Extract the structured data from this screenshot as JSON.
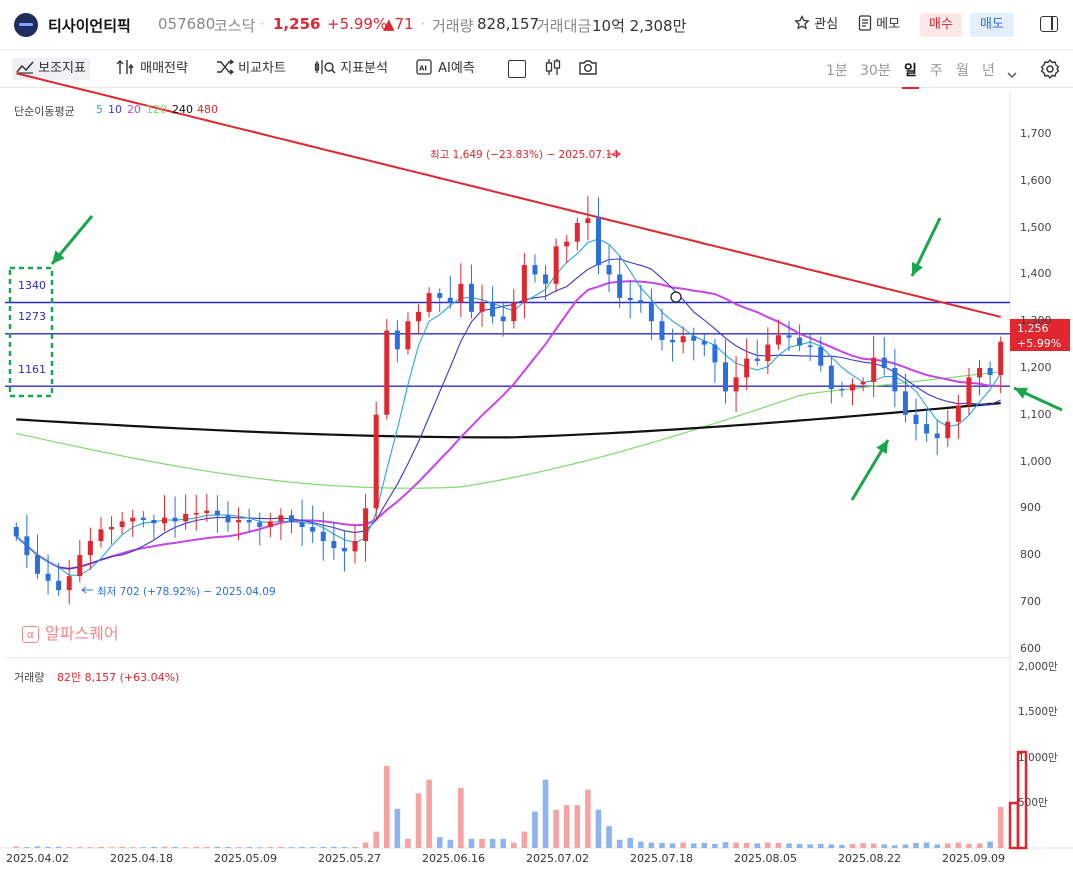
{
  "header": {
    "stock_name": "티사이언티픽",
    "stock_code": "057680",
    "market": "코스닥",
    "sep": "·",
    "price": "1,256",
    "change_pct": "+5.99%",
    "change_abs": "▲71",
    "volume_label": "거래량",
    "volume_value": "828,157",
    "amount_label": "거래대금",
    "amount_value": "10억 2,308만",
    "watch_label": "관심",
    "memo_label": "메모",
    "buy_label": "매수",
    "sell_label": "매도"
  },
  "toolbar": {
    "items": [
      "보조지표",
      "매매전략",
      "비교차트",
      "지표분석",
      "AI예측"
    ],
    "timeframes": [
      "1분",
      "30분",
      "일",
      "주",
      "월",
      "년"
    ],
    "selected_timeframe": "일"
  },
  "overlays": {
    "ma_title": "단순이동평균",
    "ma_periods": [
      "5",
      "10",
      "20",
      "120",
      "240",
      "480"
    ],
    "ma_colors": [
      "#2aa7d8",
      "#3b39c9",
      "#c944e6",
      "#7ddc6b",
      "#111111",
      "#e0262e"
    ],
    "high_note": "최고 1,649 (−23.83%) − 2025.07.14",
    "low_note": "최저 702 (+78.92%) − 2025.04.09",
    "level_labels": [
      "1340",
      "1273",
      "1161"
    ],
    "watermark": "알파스퀘어",
    "watermark_icon": "alpha-icon",
    "volume_title": "거래량",
    "volume_info": "82만 8,157 (+63.04%)",
    "price_tag": "1,256",
    "price_tag_pct": "+5.99%"
  },
  "chart_data": {
    "type": "candlestick",
    "x_labels": [
      "2025.04.02",
      "2025.04.18",
      "2025.05.09",
      "2025.05.27",
      "2025.06.16",
      "2025.07.02",
      "2025.07.18",
      "2025.08.05",
      "2025.08.22",
      "2025.09.09"
    ],
    "y_ticks": [
      "1,700",
      "1,600",
      "1,500",
      "1,400",
      "1,300",
      "1,200",
      "1,100",
      "1,000",
      "900",
      "800",
      "700",
      "600"
    ],
    "ylim": [
      580,
      1790
    ],
    "volume_ticks": [
      "2,000만",
      "1,500만",
      "1,000만",
      "500만"
    ],
    "volume_ylim": [
      0,
      2000
    ],
    "horizontal_levels": [
      1340,
      1273,
      1161
    ],
    "closes": [
      840,
      800,
      760,
      745,
      725,
      755,
      800,
      830,
      855,
      860,
      872,
      880,
      875,
      868,
      880,
      872,
      888,
      890,
      895,
      885,
      870,
      875,
      870,
      860,
      872,
      885,
      870,
      860,
      850,
      830,
      815,
      808,
      830,
      900,
      1100,
      1280,
      1240,
      1300,
      1320,
      1360,
      1350,
      1340,
      1380,
      1320,
      1340,
      1310,
      1300,
      1340,
      1420,
      1400,
      1380,
      1460,
      1470,
      1510,
      1520,
      1420,
      1400,
      1350,
      1345,
      1340,
      1300,
      1260,
      1255,
      1268,
      1258,
      1250,
      1212,
      1150,
      1180,
      1220,
      1215,
      1250,
      1270,
      1265,
      1248,
      1245,
      1205,
      1155,
      1152,
      1165,
      1170,
      1222,
      1200,
      1150,
      1100,
      1080,
      1060,
      1050,
      1085,
      1120,
      1180,
      1200,
      1185,
      1256
    ],
    "volumes": [
      15,
      10,
      18,
      12,
      14,
      8,
      10,
      9,
      11,
      8,
      12,
      10,
      9,
      12,
      14,
      11,
      9,
      13,
      10,
      12,
      11,
      9,
      10,
      8,
      10,
      12,
      9,
      11,
      10,
      12,
      13,
      10,
      12,
      60,
      180,
      900,
      430,
      100,
      600,
      750,
      120,
      90,
      660,
      100,
      100,
      100,
      100,
      60,
      180,
      400,
      750,
      420,
      470,
      470,
      640,
      420,
      240,
      90,
      110,
      70,
      60,
      55,
      50,
      60,
      50,
      55,
      45,
      65,
      60,
      55,
      50,
      60,
      55,
      50,
      45,
      40,
      45,
      40,
      35,
      45,
      55,
      50,
      40,
      30,
      40,
      55,
      60,
      40,
      50,
      60,
      45,
      50,
      70,
      450
    ],
    "volume_colors": [
      "up",
      "down"
    ]
  }
}
